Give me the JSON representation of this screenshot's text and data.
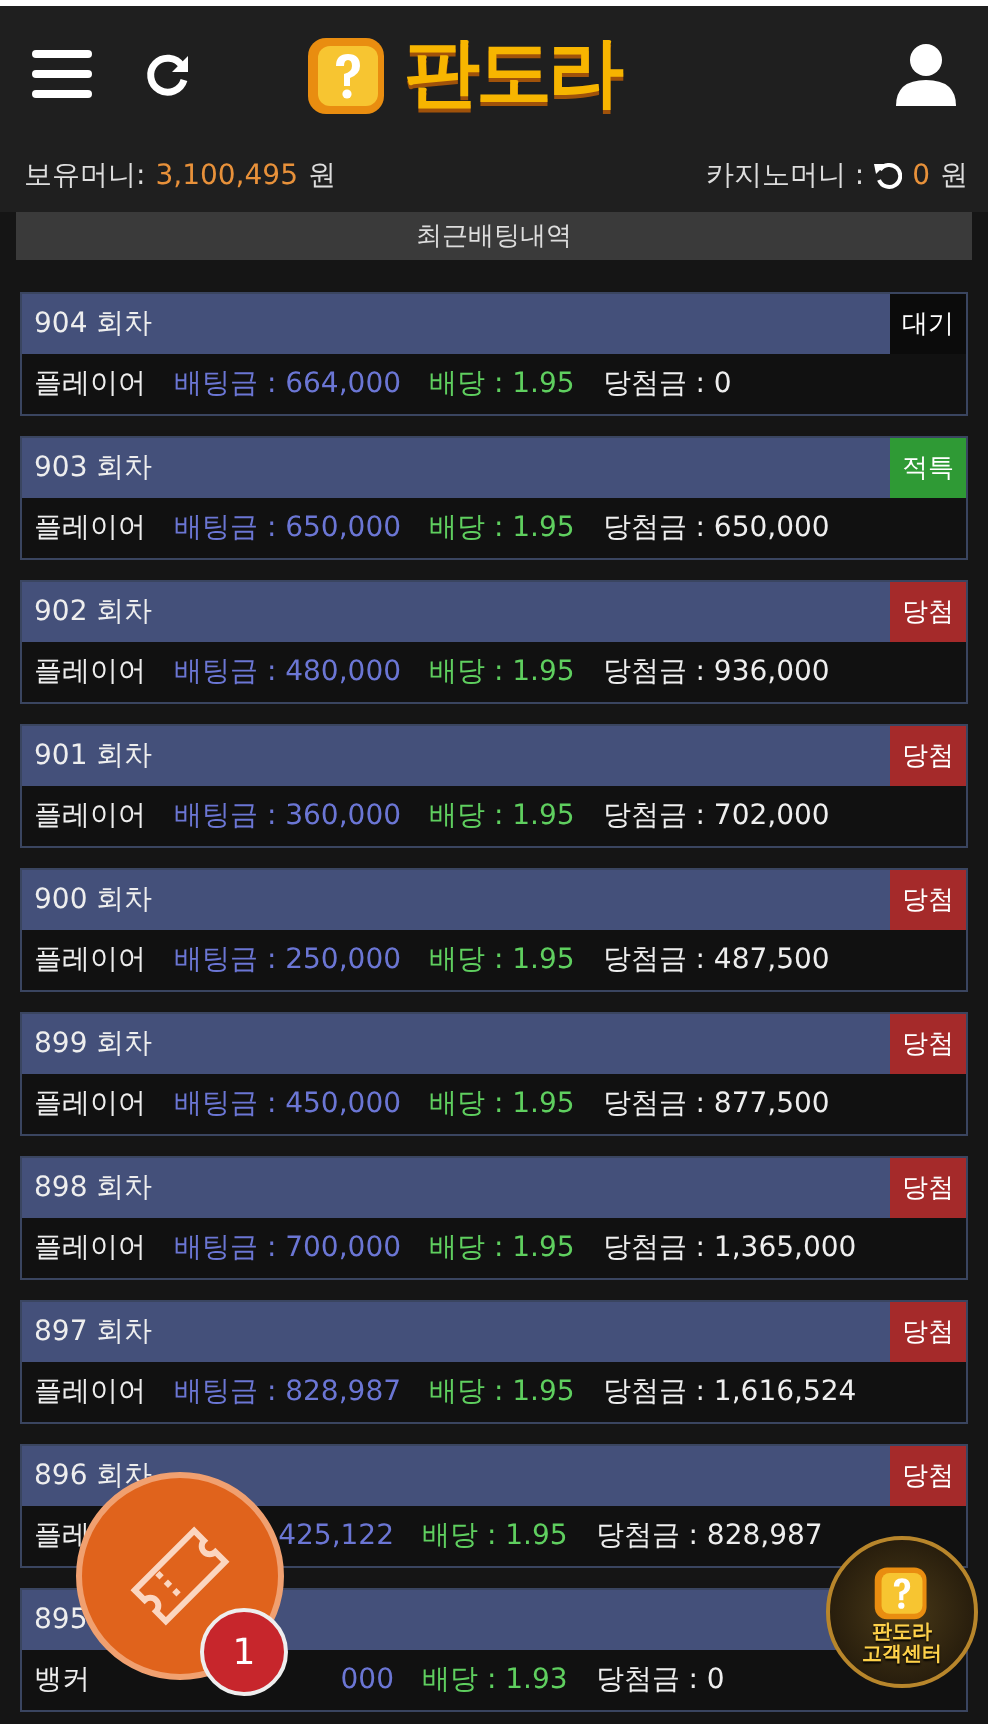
{
  "header": {
    "logo_text": "판도라"
  },
  "balance": {
    "label": "보유머니:",
    "amount": "3,100,495",
    "unit": "원"
  },
  "casino": {
    "label": "카지노머니 :",
    "amount": "0",
    "unit": "원"
  },
  "section_title": "최근배팅내역",
  "bets": [
    {
      "round": "904 회차",
      "status": "대기",
      "kind": "pending",
      "pick": "플레이어",
      "bet_label": "배팅금 :",
      "bet": "664,000",
      "odds_label": "배당 :",
      "odds": "1.95",
      "win_label": "당첨금 :",
      "win": "0"
    },
    {
      "round": "903 회차",
      "status": "적특",
      "kind": "void",
      "pick": "플레이어",
      "bet_label": "배팅금 :",
      "bet": "650,000",
      "odds_label": "배당 :",
      "odds": "1.95",
      "win_label": "당첨금 :",
      "win": "650,000"
    },
    {
      "round": "902 회차",
      "status": "당첨",
      "kind": "win",
      "pick": "플레이어",
      "bet_label": "배팅금 :",
      "bet": "480,000",
      "odds_label": "배당 :",
      "odds": "1.95",
      "win_label": "당첨금 :",
      "win": "936,000"
    },
    {
      "round": "901 회차",
      "status": "당첨",
      "kind": "win",
      "pick": "플레이어",
      "bet_label": "배팅금 :",
      "bet": "360,000",
      "odds_label": "배당 :",
      "odds": "1.95",
      "win_label": "당첨금 :",
      "win": "702,000"
    },
    {
      "round": "900 회차",
      "status": "당첨",
      "kind": "win",
      "pick": "플레이어",
      "bet_label": "배팅금 :",
      "bet": "250,000",
      "odds_label": "배당 :",
      "odds": "1.95",
      "win_label": "당첨금 :",
      "win": "487,500"
    },
    {
      "round": "899 회차",
      "status": "당첨",
      "kind": "win",
      "pick": "플레이어",
      "bet_label": "배팅금 :",
      "bet": "450,000",
      "odds_label": "배당 :",
      "odds": "1.95",
      "win_label": "당첨금 :",
      "win": "877,500"
    },
    {
      "round": "898 회차",
      "status": "당첨",
      "kind": "win",
      "pick": "플레이어",
      "bet_label": "배팅금 :",
      "bet": "700,000",
      "odds_label": "배당 :",
      "odds": "1.95",
      "win_label": "당첨금 :",
      "win": "1,365,000"
    },
    {
      "round": "897 회차",
      "status": "당첨",
      "kind": "win",
      "pick": "플레이어",
      "bet_label": "배팅금 :",
      "bet": "828,987",
      "odds_label": "배당 :",
      "odds": "1.95",
      "win_label": "당첨금 :",
      "win": "1,616,524"
    },
    {
      "round": "896 회차",
      "status": "당첨",
      "kind": "win",
      "pick": "플레",
      "bet": "425,122",
      "odds_label": "배당 :",
      "odds": "1.95",
      "win_label": "당첨금 :",
      "win": "828,987"
    },
    {
      "round": "895",
      "kind": "none",
      "pick": "뱅커",
      "bet": "000",
      "odds_label": "배당 :",
      "odds": "1.93",
      "win_label": "당첨금 :",
      "win": "0"
    }
  ],
  "ticket_button": {
    "badge": "1"
  },
  "support_button": {
    "line_1": "판도라",
    "line_2": "고객센터"
  }
}
